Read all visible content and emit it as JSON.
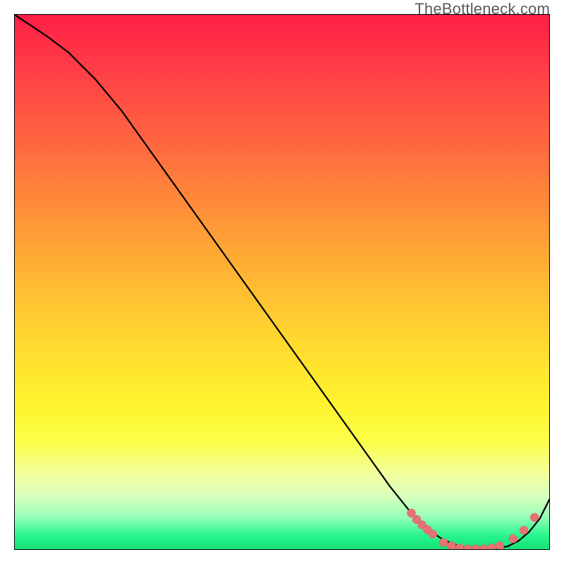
{
  "watermark": "TheBottleneck.com",
  "colors": {
    "gradient_top": "#ff1f45",
    "gradient_mid": "#ffdb2f",
    "gradient_bottom": "#15e076",
    "curve_stroke": "#000000",
    "marker_fill": "#e57373",
    "marker_stroke": "#d25f5f"
  },
  "chart_data": {
    "type": "line",
    "title": "",
    "xlabel": "",
    "ylabel": "",
    "xlim": [
      0,
      100
    ],
    "ylim": [
      0,
      100
    ],
    "grid": false,
    "legend": false,
    "series": [
      {
        "name": "curve",
        "x": [
          0,
          3,
          6,
          10,
          15,
          20,
          25,
          30,
          35,
          40,
          45,
          50,
          55,
          60,
          65,
          70,
          74,
          77,
          80,
          83,
          86,
          89,
          92,
          94,
          96,
          98,
          100
        ],
        "y": [
          100,
          98,
          96,
          93,
          88,
          82,
          75,
          68,
          61,
          54,
          47,
          40,
          33,
          26,
          19,
          12,
          7,
          4,
          2,
          0.8,
          0.3,
          0.3,
          0.8,
          1.8,
          3.5,
          6,
          10
        ]
      }
    ],
    "markers": [
      {
        "x": 74.0,
        "y": 7.0
      },
      {
        "x": 75.0,
        "y": 5.8
      },
      {
        "x": 76.0,
        "y": 4.8
      },
      {
        "x": 77.0,
        "y": 3.9
      },
      {
        "x": 78.0,
        "y": 3.1
      },
      {
        "x": 80.0,
        "y": 1.5
      },
      {
        "x": 81.5,
        "y": 0.9
      },
      {
        "x": 83.0,
        "y": 0.5
      },
      {
        "x": 84.5,
        "y": 0.3
      },
      {
        "x": 86.0,
        "y": 0.3
      },
      {
        "x": 87.5,
        "y": 0.3
      },
      {
        "x": 89.0,
        "y": 0.5
      },
      {
        "x": 90.5,
        "y": 0.9
      },
      {
        "x": 93.0,
        "y": 2.2
      },
      {
        "x": 95.0,
        "y": 3.8
      },
      {
        "x": 97.0,
        "y": 6.2
      }
    ]
  }
}
